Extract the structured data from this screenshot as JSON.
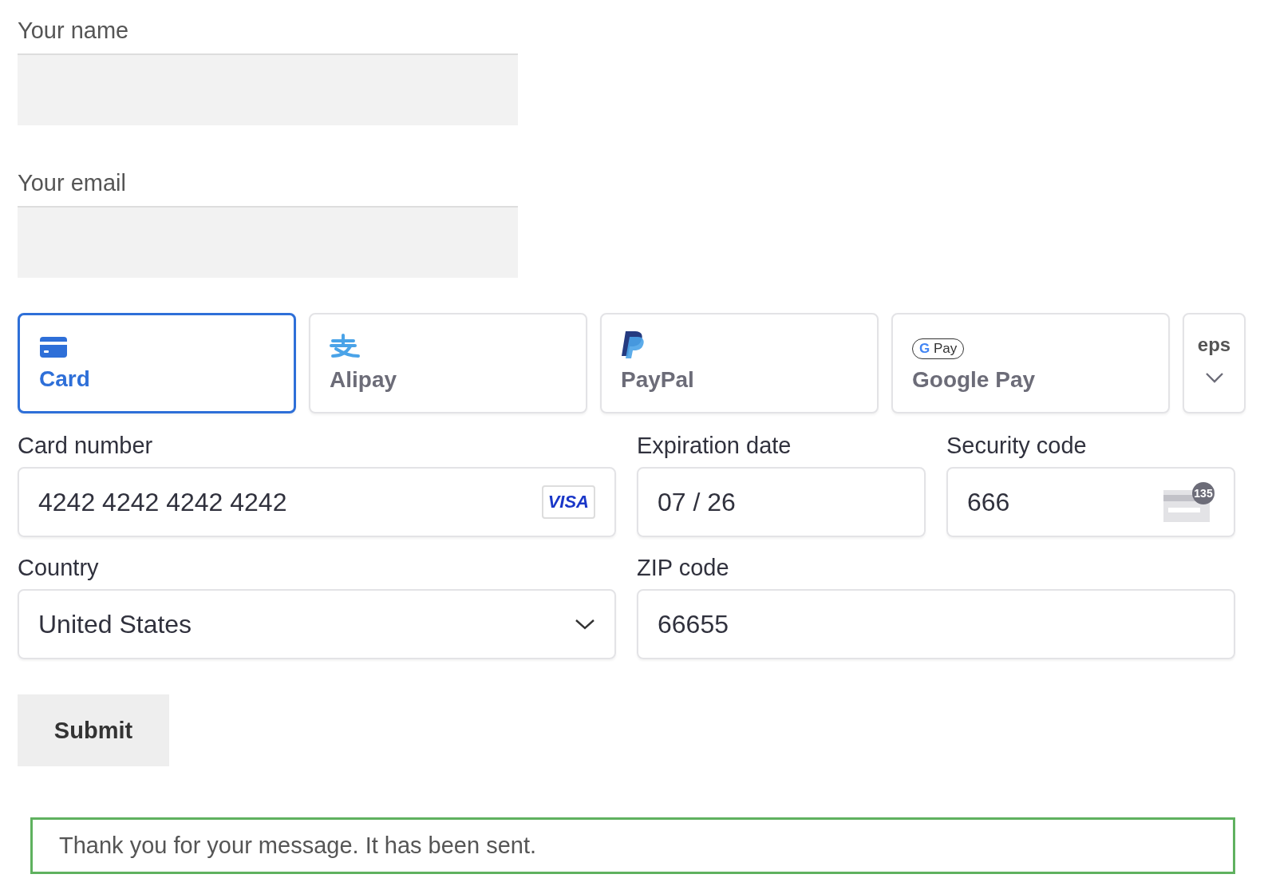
{
  "contact_fields": [
    {
      "label": "Your name"
    },
    {
      "label": "Your email"
    }
  ],
  "payment_tabs": [
    {
      "kind": "card",
      "label": "Card",
      "selected": true
    },
    {
      "kind": "alipay",
      "label": "Alipay",
      "selected": false
    },
    {
      "kind": "paypal",
      "label": "PayPal",
      "selected": false
    },
    {
      "kind": "googlepay",
      "label": "Google Pay",
      "logo_mark": "G",
      "logo_word": "Pay",
      "selected": false
    },
    {
      "kind": "more",
      "logo_word": "eps",
      "selected": false
    }
  ],
  "card_fields": [
    {
      "kind": "card_number",
      "label": "Card number",
      "value": "4242 4242 4242 4242",
      "badge": "VISA"
    },
    {
      "kind": "text",
      "label": "Expiration date",
      "value": "07 / 26"
    },
    {
      "kind": "cvc",
      "label": "Security code",
      "value": "666",
      "badge": "135"
    },
    {
      "kind": "select",
      "label": "Country",
      "value": "United States"
    },
    {
      "kind": "text",
      "label": "ZIP code",
      "value": "66655"
    }
  ],
  "submit_button": "Submit",
  "success_message": "Thank you for your message. It has been sent."
}
